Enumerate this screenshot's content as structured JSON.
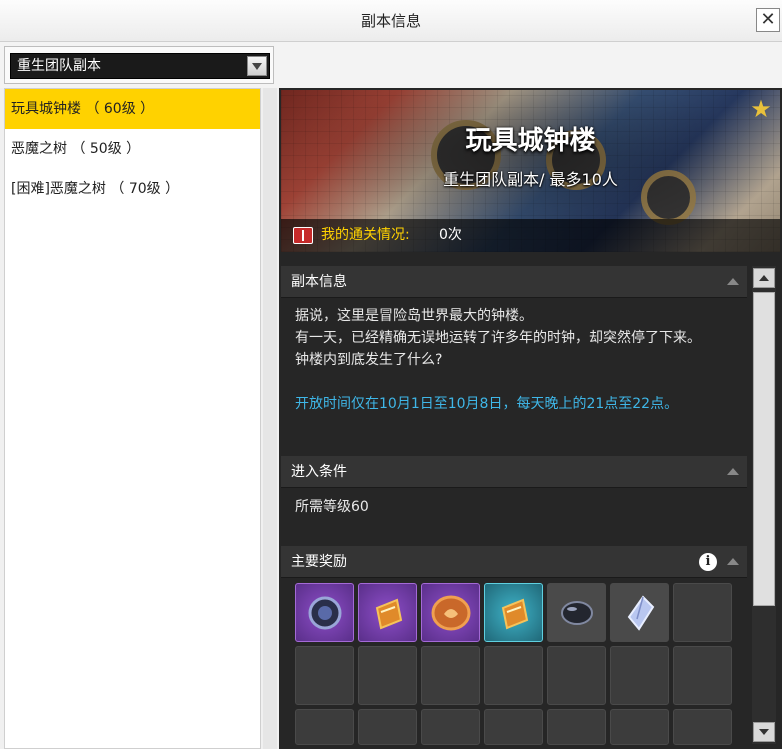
{
  "window": {
    "title": "副本信息",
    "close_label": "✕"
  },
  "dropdown": {
    "selected": "重生团队副本"
  },
  "dungeon_list": [
    {
      "label": "玩具城钟楼 （ 60级 ）",
      "selected": true
    },
    {
      "label": "恶魔之树 （ 50级 ）",
      "selected": false
    },
    {
      "label": "[困难]恶魔之树 （ 70级 ）",
      "selected": false
    }
  ],
  "banner": {
    "name": "玩具城钟楼",
    "subtitle": "重生团队副本/ 最多10人",
    "clear_label": "我的通关情况:",
    "clear_value": "0次"
  },
  "sections": {
    "info_title": "副本信息",
    "info_lines": [
      "据说，这里是冒险岛世界最大的钟楼。",
      "有一天，已经精确无误地运转了许多年的时钟，却突然停了下来。",
      "钟楼内到底发生了什么?"
    ],
    "info_highlight": "开放时间仅在10月1日至10月8日，每天晚上的21点至22点。",
    "req_title": "进入条件",
    "req_text": "所需等级60",
    "reward_title": "主要奖励",
    "info_icon_glyph": "i"
  },
  "rewards": [
    {
      "icon": "dark-orb-icon",
      "rarity": "purple"
    },
    {
      "icon": "scroll-icon",
      "rarity": "purple"
    },
    {
      "icon": "coin-medal-icon",
      "rarity": "purple"
    },
    {
      "icon": "scroll-icon",
      "rarity": "cyan"
    },
    {
      "icon": "dark-stone-icon",
      "rarity": "gray"
    },
    {
      "icon": "crystal-icon",
      "rarity": "gray"
    }
  ],
  "colors": {
    "selected_item": "#ffd200",
    "highlight_text": "#3fb7e8",
    "clear_label": "#ffd200"
  }
}
